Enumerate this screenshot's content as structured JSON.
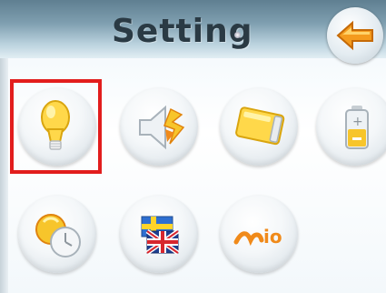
{
  "header": {
    "title": "Setting",
    "back_button_icon": "back-arrow-icon"
  },
  "settings_grid": {
    "items": [
      {
        "icon": "brightness-bulb-icon",
        "selected": true
      },
      {
        "icon": "volume-speaker-icon",
        "selected": false
      },
      {
        "icon": "touch-calibration-card-icon",
        "selected": false
      },
      {
        "icon": "battery-icon",
        "selected": false
      },
      {
        "icon": "date-time-clock-icon",
        "selected": false
      },
      {
        "icon": "language-flags-icon",
        "selected": false
      },
      {
        "icon": "about-mio-logo-icon",
        "selected": false
      }
    ],
    "logo_text": "io"
  },
  "colors": {
    "selection": "#e21d1d",
    "accent_yellow": "#f7c52b",
    "accent_orange": "#f08a1a"
  }
}
